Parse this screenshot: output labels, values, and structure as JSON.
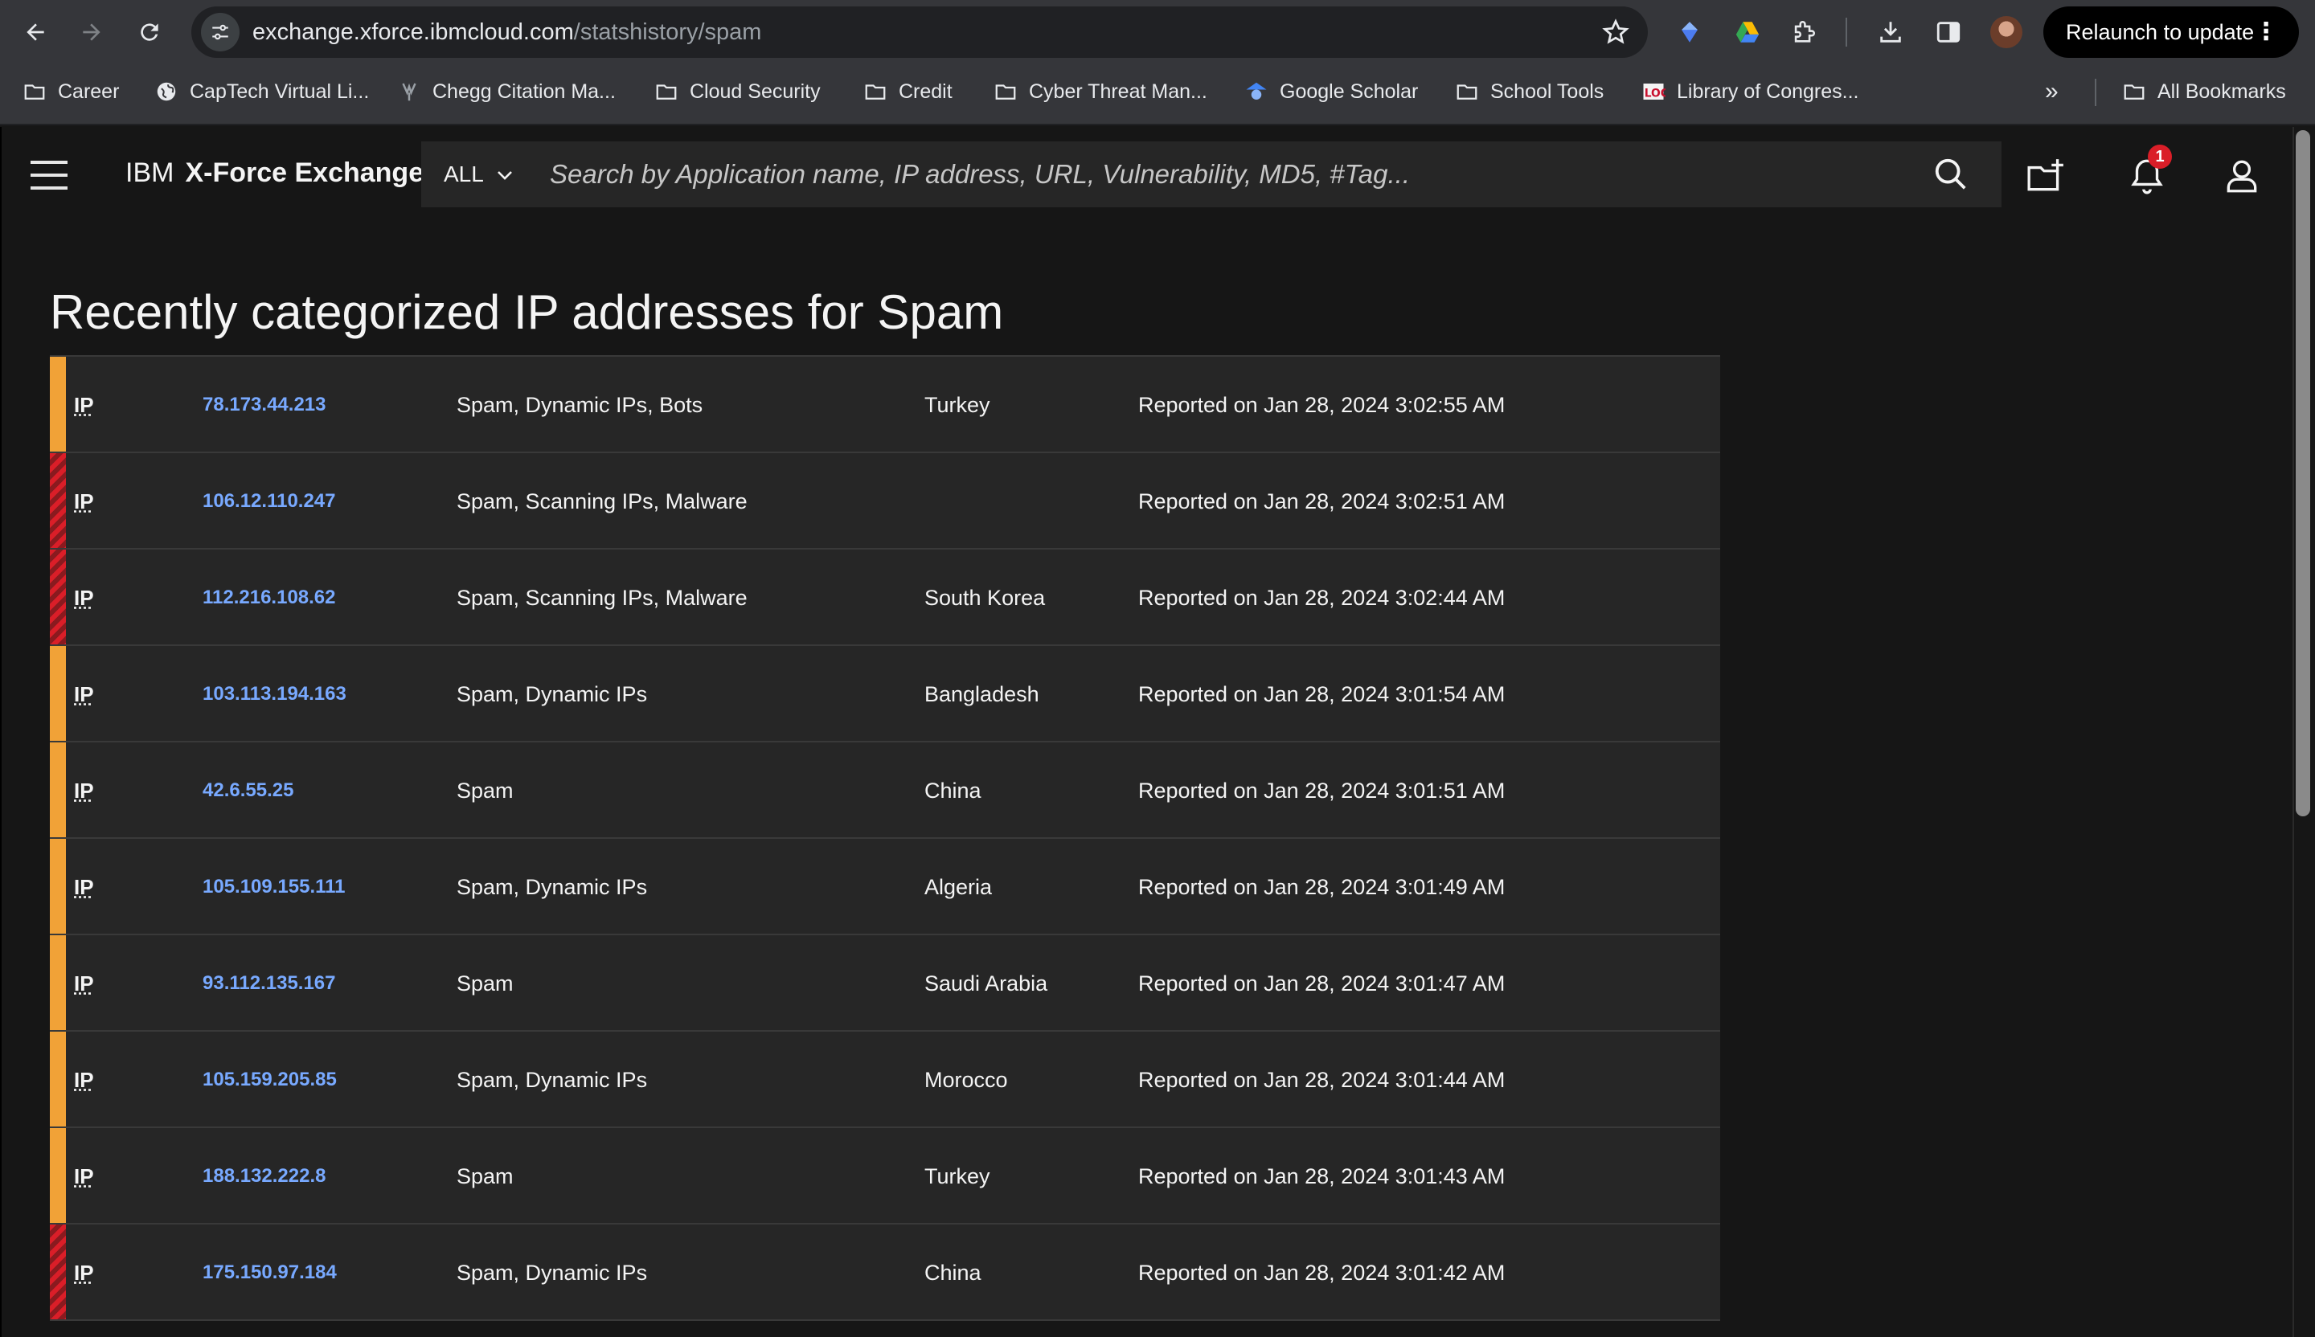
{
  "browser": {
    "url_host": "exchange.xforce.ibmcloud.com",
    "url_path": "/statshistory/spam",
    "relaunch_label": "Relaunch to update",
    "bookmarks": [
      {
        "label": "Career",
        "icon": "folder-icon"
      },
      {
        "label": "CapTech Virtual Li...",
        "icon": "globe-icon"
      },
      {
        "label": "Chegg Citation Ma...",
        "icon": "chegg-icon"
      },
      {
        "label": "Cloud Security",
        "icon": "folder-icon"
      },
      {
        "label": "Credit",
        "icon": "folder-icon"
      },
      {
        "label": "Cyber Threat Man...",
        "icon": "folder-icon"
      },
      {
        "label": "Google Scholar",
        "icon": "scholar-icon"
      },
      {
        "label": "School Tools",
        "icon": "folder-icon"
      },
      {
        "label": "Library of Congres...",
        "icon": "loc-icon"
      }
    ],
    "all_bookmarks_label": "All Bookmarks"
  },
  "header": {
    "brand_ibm": "IBM",
    "brand_product": "X-Force Exchange",
    "scope": "ALL",
    "search_placeholder": "Search by Application name, IP address, URL, Vulnerability, MD5, #Tag...",
    "notification_count": "1"
  },
  "page": {
    "title": "Recently categorized IP addresses for Spam"
  },
  "rows": [
    {
      "type": "IP",
      "ip": "78.173.44.213",
      "categories": "Spam, Dynamic IPs, Bots",
      "country": "Turkey",
      "reported": "Reported on Jan 28, 2024 3:02:55 AM",
      "risk": "medium"
    },
    {
      "type": "IP",
      "ip": "106.12.110.247",
      "categories": "Spam, Scanning IPs, Malware",
      "country": "",
      "reported": "Reported on Jan 28, 2024 3:02:51 AM",
      "risk": "high"
    },
    {
      "type": "IP",
      "ip": "112.216.108.62",
      "categories": "Spam, Scanning IPs, Malware",
      "country": "South Korea",
      "reported": "Reported on Jan 28, 2024 3:02:44 AM",
      "risk": "high"
    },
    {
      "type": "IP",
      "ip": "103.113.194.163",
      "categories": "Spam, Dynamic IPs",
      "country": "Bangladesh",
      "reported": "Reported on Jan 28, 2024 3:01:54 AM",
      "risk": "medium"
    },
    {
      "type": "IP",
      "ip": "42.6.55.25",
      "categories": "Spam",
      "country": "China",
      "reported": "Reported on Jan 28, 2024 3:01:51 AM",
      "risk": "medium"
    },
    {
      "type": "IP",
      "ip": "105.109.155.111",
      "categories": "Spam, Dynamic IPs",
      "country": "Algeria",
      "reported": "Reported on Jan 28, 2024 3:01:49 AM",
      "risk": "medium"
    },
    {
      "type": "IP",
      "ip": "93.112.135.167",
      "categories": "Spam",
      "country": "Saudi Arabia",
      "reported": "Reported on Jan 28, 2024 3:01:47 AM",
      "risk": "medium"
    },
    {
      "type": "IP",
      "ip": "105.159.205.85",
      "categories": "Spam, Dynamic IPs",
      "country": "Morocco",
      "reported": "Reported on Jan 28, 2024 3:01:44 AM",
      "risk": "medium"
    },
    {
      "type": "IP",
      "ip": "188.132.222.8",
      "categories": "Spam",
      "country": "Turkey",
      "reported": "Reported on Jan 28, 2024 3:01:43 AM",
      "risk": "medium"
    },
    {
      "type": "IP",
      "ip": "175.150.97.184",
      "categories": "Spam, Dynamic IPs",
      "country": "China",
      "reported": "Reported on Jan 28, 2024 3:01:42 AM",
      "risk": "high"
    }
  ],
  "colors": {
    "risk_medium": "#f1a237",
    "risk_high": "#da1e28",
    "link": "#78a9ff"
  }
}
